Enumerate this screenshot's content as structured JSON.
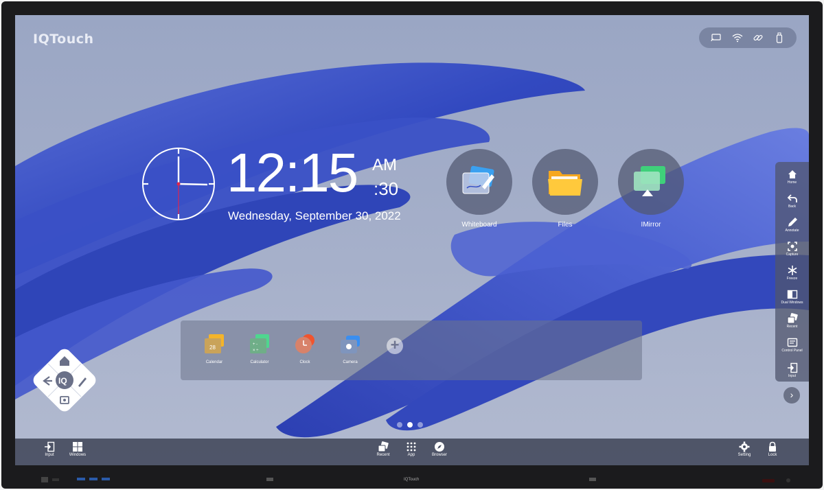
{
  "brand": {
    "logo": "IQTouch",
    "bezel_brand": "IQTouch"
  },
  "clock": {
    "time": "12:15",
    "ampm": "AM",
    "seconds": ":30",
    "date": "Wednesday, September 30, 2022"
  },
  "apps": [
    {
      "label": "Whiteboard",
      "icon": "whiteboard-icon"
    },
    {
      "label": "Files",
      "icon": "folder-icon"
    },
    {
      "label": "IMirror",
      "icon": "screen-mirror-icon"
    }
  ],
  "dock": {
    "items": [
      {
        "label": "Calendar",
        "icon": "calendar-icon",
        "badge": "28"
      },
      {
        "label": "Calculator",
        "icon": "calculator-icon"
      },
      {
        "label": "Clock",
        "icon": "clock-icon"
      },
      {
        "label": "Camera",
        "icon": "camera-icon"
      }
    ],
    "add_label": "+"
  },
  "status_bar": {
    "icons": [
      "cast-icon",
      "wifi-icon",
      "link-icon",
      "usb-icon"
    ]
  },
  "sidebar": {
    "items": [
      {
        "label": "Home",
        "icon": "home-icon"
      },
      {
        "label": "Back",
        "icon": "back-icon"
      },
      {
        "label": "Annotate",
        "icon": "pen-icon"
      },
      {
        "label": "Capture",
        "icon": "capture-icon"
      },
      {
        "label": "Freeze",
        "icon": "snowflake-icon"
      },
      {
        "label": "Dual Windows",
        "icon": "split-window-icon"
      },
      {
        "label": "Recent",
        "icon": "recent-icon"
      },
      {
        "label": "Control Panel",
        "icon": "control-panel-icon"
      },
      {
        "label": "Input",
        "icon": "input-icon"
      }
    ],
    "next_label": "›"
  },
  "taskbar": {
    "left": [
      {
        "label": "Input",
        "icon": "input-icon"
      },
      {
        "label": "Windows",
        "icon": "windows-icon"
      }
    ],
    "center": [
      {
        "label": "Recent",
        "icon": "recent-icon"
      },
      {
        "label": "App",
        "icon": "apps-grid-icon"
      },
      {
        "label": "Browser",
        "icon": "compass-icon"
      }
    ],
    "right": [
      {
        "label": "Setting",
        "icon": "gear-icon"
      },
      {
        "label": "Lock",
        "icon": "lock-icon"
      }
    ]
  },
  "pagination": {
    "pages": 3,
    "active": 2
  },
  "colors": {
    "wallpaper_blue": "#3a52c4",
    "bezel": "#1b1b1d",
    "taskbar": "#464c60"
  }
}
